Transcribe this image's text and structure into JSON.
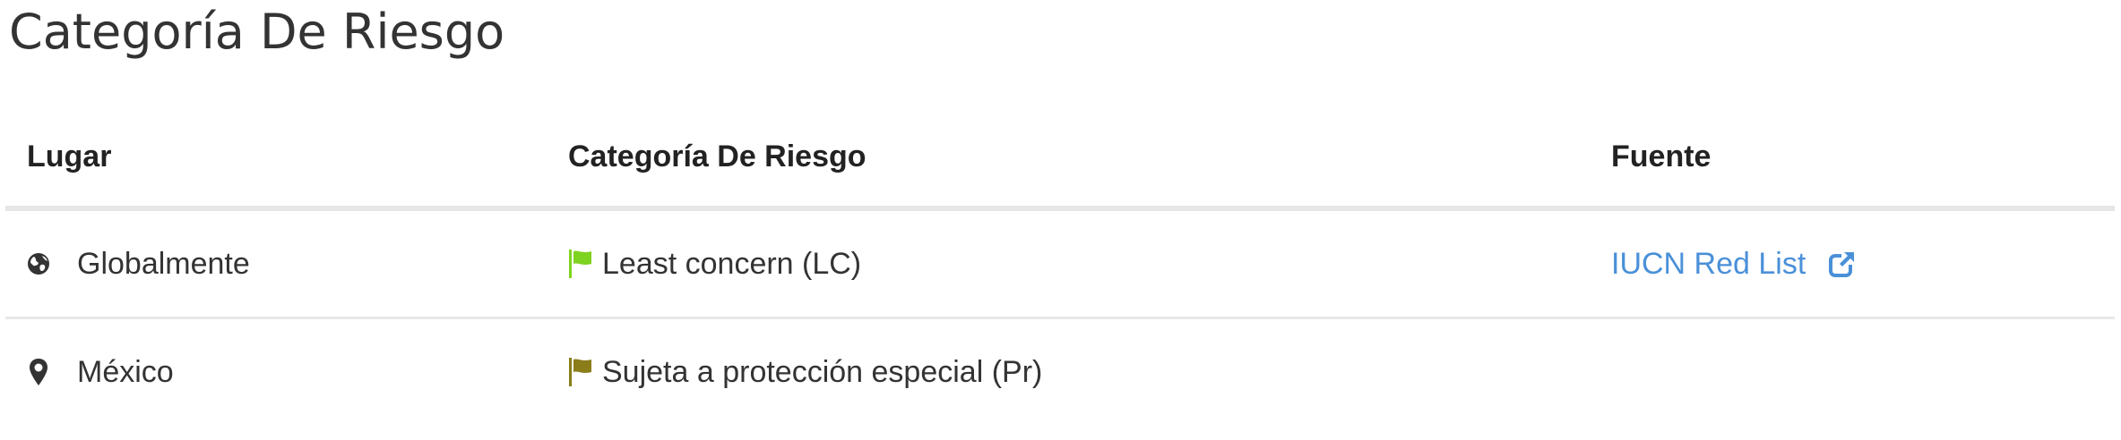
{
  "page": {
    "title": "Categoría De Riesgo"
  },
  "table": {
    "headers": {
      "place": "Lugar",
      "category": "Categoría De Riesgo",
      "source": "Fuente"
    },
    "rows": [
      {
        "place": "Globalmente",
        "place_icon": "globe-icon",
        "category": "Least concern (LC)",
        "flag_color": "#7ed321",
        "source": "IUCN Red List",
        "source_icon": "external-link-icon"
      },
      {
        "place": "México",
        "place_icon": "map-marker-icon",
        "category": "Sujeta a protección especial (Pr)",
        "flag_color": "#8a7d1a",
        "source": ""
      }
    ]
  },
  "colors": {
    "link": "#4a90d9",
    "divider": "#e6e6e6",
    "text": "#333333"
  }
}
